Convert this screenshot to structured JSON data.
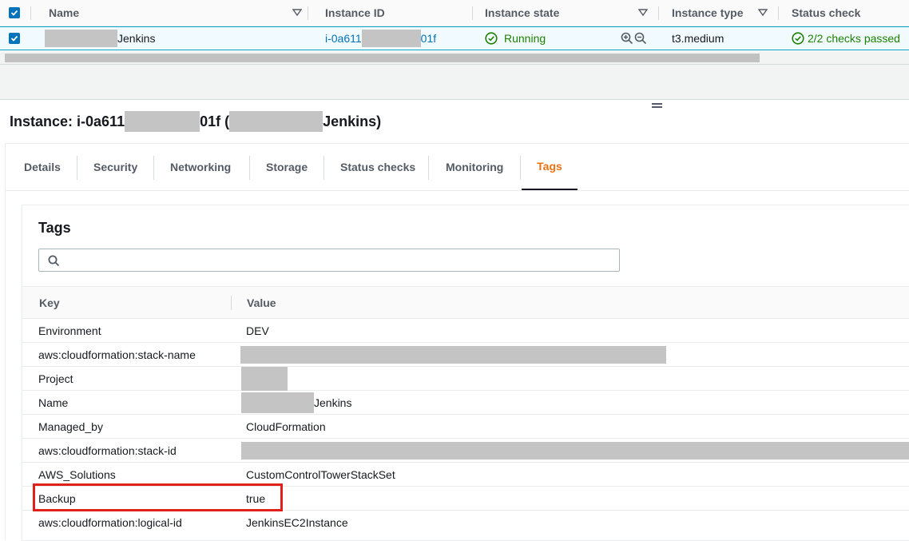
{
  "instances_table": {
    "columns": [
      "Name",
      "Instance ID",
      "Instance state",
      "Instance type",
      "Status check"
    ],
    "row": {
      "name_suffix": "Jenkins",
      "instance_id_prefix": "i-0a611",
      "instance_id_suffix": "01f",
      "state": "Running",
      "type": "t3.medium",
      "status_check": "2/2 checks passed"
    }
  },
  "details": {
    "title_prefix": "Instance: i-0a611",
    "title_mid": "01f (",
    "title_suffix": "Jenkins)",
    "tabs": [
      "Details",
      "Security",
      "Networking",
      "Storage",
      "Status checks",
      "Monitoring",
      "Tags"
    ],
    "active_tab": "Tags"
  },
  "tags": {
    "heading": "Tags",
    "search_placeholder": "",
    "columns": {
      "key": "Key",
      "value": "Value"
    },
    "rows": [
      {
        "key": "Environment",
        "value": "DEV"
      },
      {
        "key": "aws:cloudformation:stack-name",
        "value": ""
      },
      {
        "key": "Project",
        "value": ""
      },
      {
        "key": "Name",
        "value": "Jenkins"
      },
      {
        "key": "Managed_by",
        "value": "CloudFormation"
      },
      {
        "key": "aws:cloudformation:stack-id",
        "value": ""
      },
      {
        "key": "AWS_Solutions",
        "value": "CustomControlTowerStackSet"
      },
      {
        "key": "Backup",
        "value": "true"
      },
      {
        "key": "aws:cloudformation:logical-id",
        "value": "JenkinsEC2Instance"
      }
    ]
  },
  "colors": {
    "link": "#0073bb",
    "running_green": "#1d8102",
    "active_tab": "#ec7211",
    "highlight_red": "#e0201b"
  }
}
